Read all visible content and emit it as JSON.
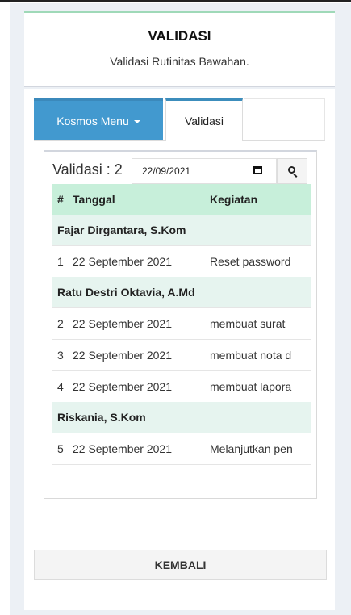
{
  "header": {
    "title": "VALIDASI",
    "subtitle": "Validasi Rutinitas Bawahan."
  },
  "tabs": [
    {
      "label": "Kosmos Menu",
      "active": false,
      "has_dropdown": true
    },
    {
      "label": "Validasi",
      "active": true
    }
  ],
  "validasi": {
    "title": "Validasi : 2",
    "date_value": "22/09/2021",
    "calendar_icon": "calendar-icon",
    "search_icon": "search-icon",
    "columns": [
      "#",
      "Tanggal",
      "Kegiatan"
    ],
    "groups": [
      {
        "name": "Fajar Dirgantara, S.Kom",
        "rows": [
          {
            "no": "1",
            "tanggal": "22 September 2021",
            "kegiatan": "Reset password"
          }
        ]
      },
      {
        "name": "Ratu Destri Oktavia, A.Md",
        "rows": [
          {
            "no": "2",
            "tanggal": "22 September 2021",
            "kegiatan": "membuat surat"
          },
          {
            "no": "3",
            "tanggal": "22 September 2021",
            "kegiatan": "membuat nota d"
          },
          {
            "no": "4",
            "tanggal": "22 September 2021",
            "kegiatan": "membuat lapora"
          }
        ]
      },
      {
        "name": "Riskania, S.Kom",
        "rows": [
          {
            "no": "5",
            "tanggal": "22 September 2021",
            "kegiatan": "Melanjutkan pen"
          }
        ]
      }
    ]
  },
  "actions": {
    "back_label": "KEMBALI"
  },
  "colors": {
    "accent": "#4299cf",
    "header_row": "#c7efda",
    "group_row": "#e6f4ef",
    "background": "#ecf0f5"
  }
}
